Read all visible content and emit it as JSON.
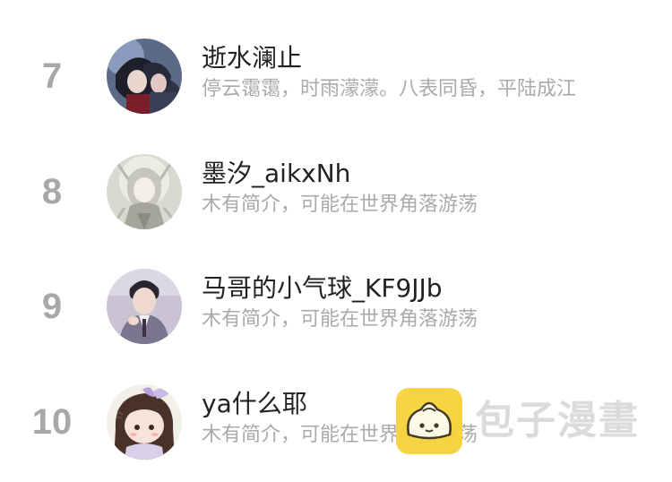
{
  "ranking": {
    "items": [
      {
        "rank": "7",
        "name": "逝水澜止",
        "bio": "停云霭霭，时雨濛濛。八表同昏，平陆成江",
        "avatar_icon": "avatar-dark-couple"
      },
      {
        "rank": "8",
        "name": "墨汐_aikxNh",
        "bio": "木有简介，可能在世界角落游荡",
        "avatar_icon": "avatar-pale-figure"
      },
      {
        "rank": "9",
        "name": "马哥的小气球_KF9JJb",
        "bio": "木有简介，可能在世界角落游荡",
        "avatar_icon": "avatar-boy-in-suit"
      },
      {
        "rank": "10",
        "name": "ya什么耶",
        "bio": "木有简介，可能在世界角落游荡",
        "avatar_icon": "avatar-chibi-girl"
      }
    ]
  },
  "watermark": {
    "text": "包子漫畫",
    "logo_icon": "bun-logo-icon",
    "logo_color": "#f7d23a"
  },
  "colors": {
    "rank": "#a8a8a8",
    "name": "#222222",
    "bio": "#aaaaaa",
    "background": "#ffffff"
  }
}
